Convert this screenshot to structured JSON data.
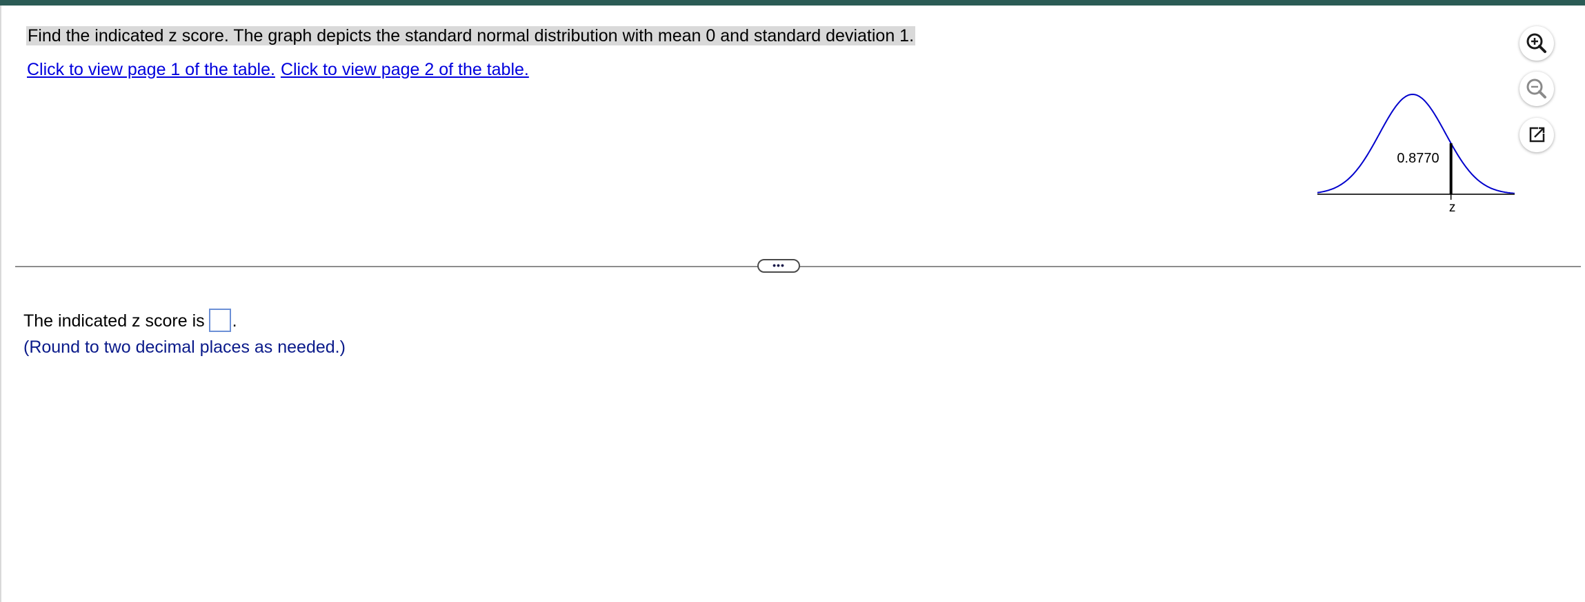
{
  "question": {
    "text": "Find the indicated z score. The graph depicts the standard normal distribution with mean 0 and standard deviation 1.",
    "link_page1": "Click to view page 1 of the table.",
    "link_page2": "Click to view page 2 of the table."
  },
  "graph": {
    "area_label": "0.8770",
    "z_label": "z",
    "shaded_area_left_of_z": 0.877,
    "curve_color": "#0000cc"
  },
  "toolbar": {
    "zoom_in_icon": "zoom-in-icon",
    "zoom_out_icon": "zoom-out-icon",
    "popout_icon": "popout-icon"
  },
  "divider": {
    "more_label": "•••"
  },
  "answer": {
    "prefix": "The indicated z score is",
    "suffix": ".",
    "value": "",
    "hint": "(Round to two decimal places as needed.)"
  },
  "colors": {
    "top_bar": "#2b5b55",
    "link": "#0000dd",
    "hint": "#0a1a8a",
    "input_border": "#6b8fd6"
  }
}
